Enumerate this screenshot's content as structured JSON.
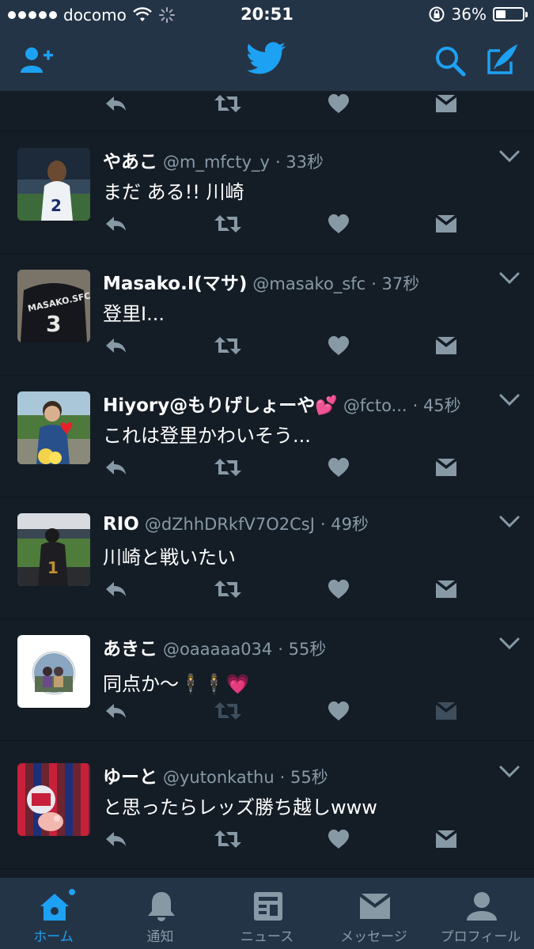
{
  "status_bar": {
    "carrier": "docomo",
    "time": "20:51",
    "battery": "36%",
    "battery_level": 0.36
  },
  "nav_icons": [
    "add-user-icon",
    "twitter-bird-icon",
    "search-icon",
    "compose-icon"
  ],
  "tweets": [
    {
      "name": "やあこ",
      "handle": "@m_mfcty_y",
      "time": "· 33秒",
      "text": "まだ ある!! 川崎"
    },
    {
      "name": "Masako.I(マサ)",
      "handle": "@masako_sfc",
      "time": "· 37秒",
      "text": "登里I..."
    },
    {
      "name": "Hiyory@もりげしょーや💕",
      "handle": "@fcto...",
      "time": "· 45秒",
      "text": "これは登里かわいそう..."
    },
    {
      "name": "RIO",
      "handle": "@dZhhDRkfV7O2CsJ",
      "time": "· 49秒",
      "text": "川崎と戦いたい"
    },
    {
      "name": "あきこ",
      "handle": "@oaaaaa034",
      "time": "· 55秒",
      "text": "同点か〜🕴🕴💗"
    },
    {
      "name": "ゆーと",
      "handle": "@yutonkathu",
      "time": "· 55秒",
      "text": "と思ったらレッズ勝ち越しwww"
    }
  ],
  "tabs": [
    {
      "label": "ホーム",
      "icon": "home-icon",
      "active": true
    },
    {
      "label": "通知",
      "icon": "bell-icon",
      "active": false
    },
    {
      "label": "ニュース",
      "icon": "news-icon",
      "active": false
    },
    {
      "label": "メッセージ",
      "icon": "message-icon",
      "active": false
    },
    {
      "label": "プロフィール",
      "icon": "profile-icon",
      "active": false
    }
  ],
  "colors": {
    "accent": "#1da1f2",
    "background": "#141d26",
    "bars": "#243447",
    "secondary_text": "#8899a6"
  }
}
